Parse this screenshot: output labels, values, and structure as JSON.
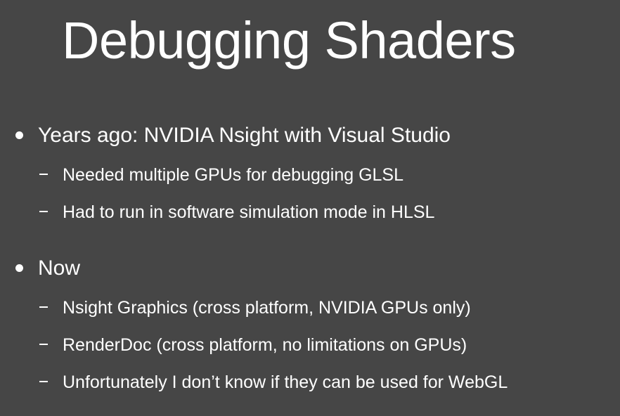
{
  "slide": {
    "title": "Debugging Shaders",
    "bullets": [
      {
        "text": "Years ago: NVIDIA Nsight with Visual Studio",
        "subs": [
          "Needed multiple GPUs for debugging GLSL",
          "Had to run in software simulation mode in HLSL"
        ]
      },
      {
        "text": "Now",
        "subs": [
          "Nsight Graphics (cross platform, NVIDIA GPUs only)",
          "RenderDoc (cross platform, no limitations on GPUs)",
          "Unfortunately I don’t know if they can be used for WebGL"
        ]
      }
    ]
  },
  "colors": {
    "background": "#464646",
    "text": "#ffffff"
  }
}
